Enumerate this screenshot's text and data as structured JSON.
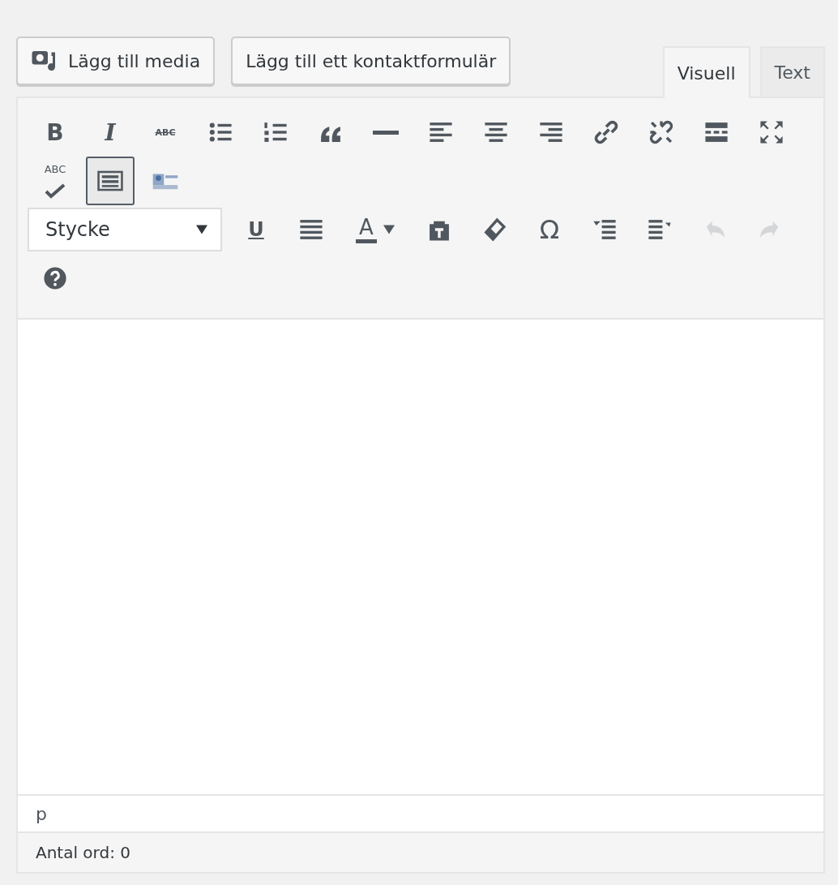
{
  "media_buttons": [
    {
      "label": "Lägg till media",
      "kind": "media"
    },
    {
      "label": "Lägg till ett kontaktformulär",
      "kind": "plain"
    }
  ],
  "tabs": [
    {
      "label": "Visuell",
      "selected": true
    },
    {
      "label": "Text",
      "selected": false
    }
  ],
  "toolbar_1": [
    {
      "label": "B",
      "pressed": false
    },
    {
      "label": "I",
      "pressed": false
    },
    {
      "label": "ABC",
      "pressed": false
    },
    {
      "pressed": false
    },
    {
      "pressed": false
    },
    {
      "pressed": false
    },
    {
      "pressed": false
    },
    {
      "pressed": false
    },
    {
      "pressed": false
    },
    {
      "pressed": false
    },
    {
      "pressed": false
    },
    {
      "pressed": false
    },
    {
      "pressed": false
    },
    {
      "pressed": false
    },
    {
      "label": "ABC",
      "pressed": false
    },
    {
      "pressed": true
    },
    {
      "pressed": false
    }
  ],
  "format_select": {
    "value": "Stycke"
  },
  "toolbar_2": [
    {
      "label": "U",
      "disabled": false
    },
    {
      "disabled": false
    },
    {
      "label": "A",
      "disabled": false
    },
    {
      "disabled": false
    },
    {
      "disabled": false
    },
    {
      "label": "Ω",
      "disabled": false
    },
    {
      "disabled": false
    },
    {
      "disabled": false
    },
    {
      "disabled": true
    },
    {
      "disabled": true
    },
    {
      "disabled": false
    }
  ],
  "path": "p",
  "word_count": "Antal ord: 0"
}
